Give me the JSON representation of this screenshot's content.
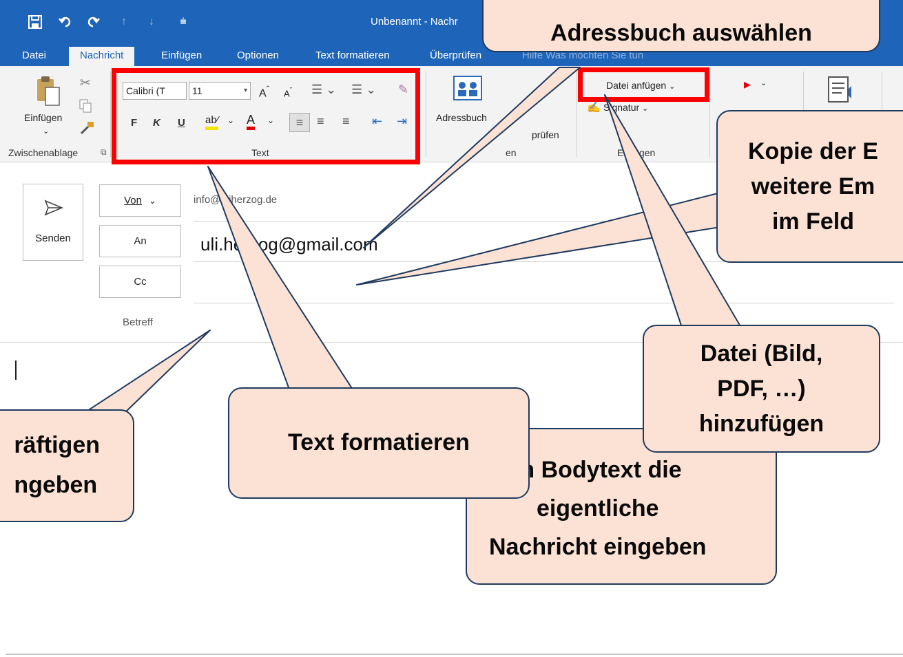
{
  "window": {
    "title": "Unbenannt - Nachr",
    "quick_access": [
      "save-icon",
      "undo-icon",
      "redo-icon",
      "up-icon",
      "down-icon",
      "customize-icon"
    ]
  },
  "tabs": [
    {
      "label": "Datei"
    },
    {
      "label": "Nachricht"
    },
    {
      "label": "Einfügen"
    },
    {
      "label": "Optionen"
    },
    {
      "label": "Text formatieren"
    },
    {
      "label": "Überprüfen"
    }
  ],
  "tabs_obscured": "Hilfe   Was möchten Sie tun",
  "ribbon": {
    "paste_label": "Einfügen",
    "clipboard_group": "Zwischenablage",
    "font_name": "Calibri (T",
    "font_size": "11",
    "format_bold": "F",
    "format_italic": "K",
    "format_underline": "U",
    "text_group": "Text",
    "address_book_label": "Adressbuch",
    "check_names_label": "prüfen",
    "names_group_fragment": "en",
    "attach_file_label": "Datei anfügen",
    "signature_label": "Signatur",
    "include_group": "Einfügen"
  },
  "compose": {
    "send_label": "Senden",
    "from_label": "Von",
    "from_value": "info@uliherzog.de",
    "to_label": "An",
    "to_value": "uli.herzog@gmail.com",
    "cc_label": "Cc",
    "subject_label": "Betreff"
  },
  "callouts": {
    "address_book": "Adressbuch auswählen",
    "cc": "Kopie der E\nweitere Em\nim Feld",
    "attach": "Datei (Bild,\nPDF, …)\nhinzufügen",
    "subject": "räftigen\nngeben",
    "format": "Text formatieren",
    "body": "m Bodytext die\neigentliche\nNachricht eingeben"
  },
  "colors": {
    "titlebar": "#1e64b8",
    "ribbon": "#f3f3f3",
    "highlight": "#ff0000",
    "callout_fill": "#fbe2d5",
    "callout_border": "#1f3a5f"
  }
}
